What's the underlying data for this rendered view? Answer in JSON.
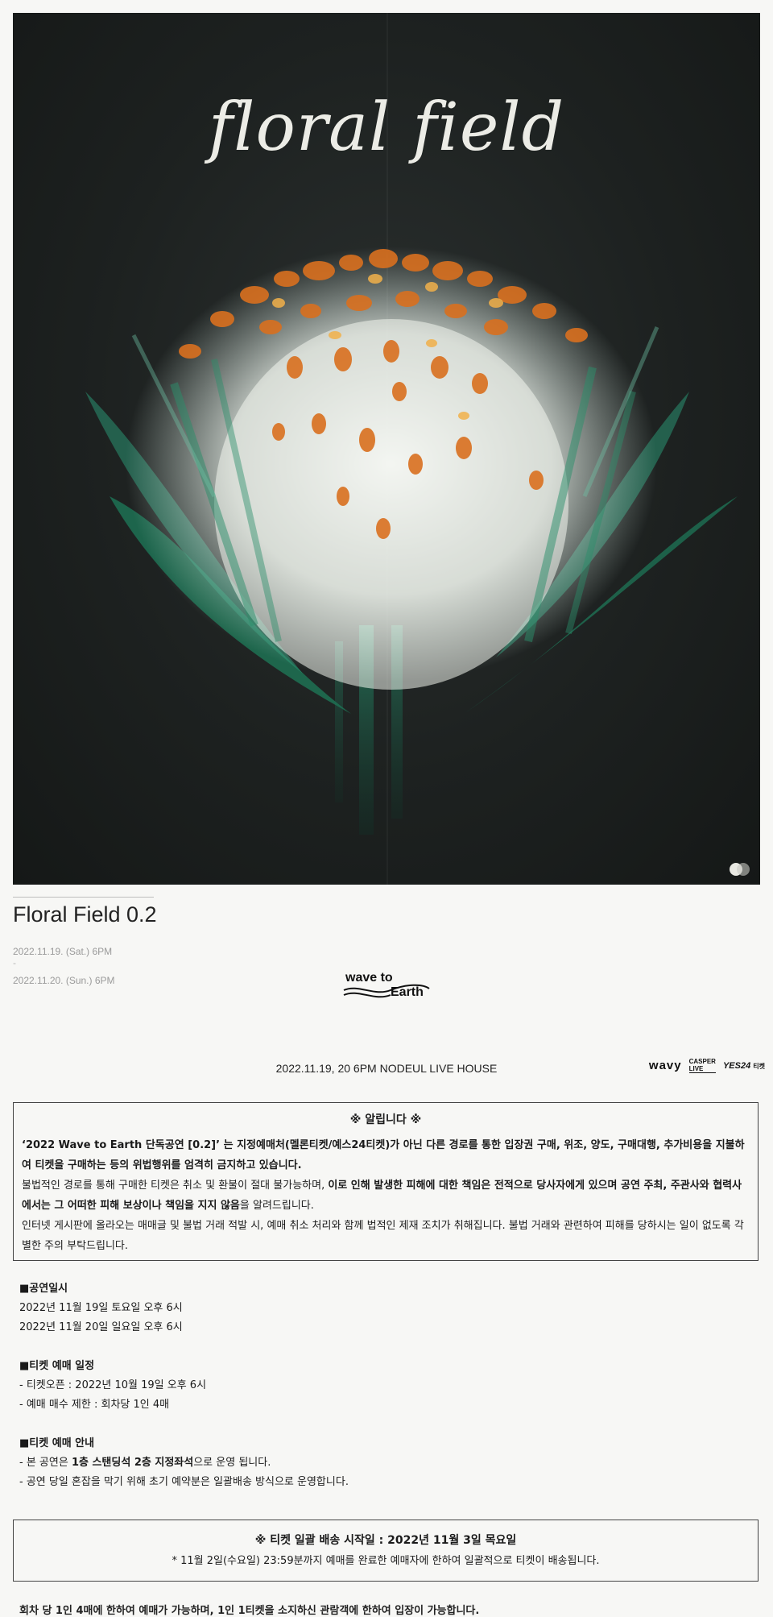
{
  "poster": {
    "title": "floral field"
  },
  "event": {
    "title": "Floral Field 0.2",
    "date1": "2022.11.19. (Sat.) 6PM",
    "separator": "-",
    "date2": "2022.11.20. (Sun.) 6PM",
    "band_logo_line1": "wave to",
    "band_logo_line2": "Earth"
  },
  "venue": {
    "line": "2022.11.19, 20 6PM NODEUL LIVE HOUSE"
  },
  "sponsors": {
    "wavy": "wavy",
    "casper_top": "CASPER",
    "casper_bottom": "LIVE",
    "yes24": "YES24",
    "yes24_suffix": "티켓"
  },
  "notice": {
    "title": "※ 알립니다 ※",
    "p1_bold": "‘2022 Wave to Earth 단독공연 [0.2]’ 는 지정예매처(멜론티켓/예스24티켓)가 아닌 다른 경로를 통한 입장권 구매, 위조, 양도, 구매대행, 추가비용을 지불하여 티켓을 구매하는 등의 위법행위를 엄격히 금지하고 있습니다.",
    "p2_normal": "불법적인 경로를 통해 구매한 티켓은 취소 및 환불이 절대 불가능하며, ",
    "p2_bold": "이로 인해 발생한 피해에 대한 책임은 전적으로 당사자에게 있으며 공연 주최, 주관사와 협력사에서는 그 어떠한 피해 보상이나 책임을 지지 않음",
    "p2_tail": "을 알려드립니다.",
    "p3": "인터넷 게시판에 올라오는 매매글 및 불법 거래 적발 시, 예매 취소 처리와 함께 법적인 제재 조치가 취해집니다. 불법 거래와 관련하여 피해를 당하시는 일이 없도록 각별한 주의 부탁드립니다."
  },
  "schedule": {
    "heading": "■공연일시",
    "line1": "2022년 11월 19일 토요일 오후 6시",
    "line2": "2022년 11월 20일 일요일 오후 6시"
  },
  "booking_schedule": {
    "heading": "■티켓 예매 일정",
    "line1": "- 티켓오픈 : 2022년 10월 19일 오후 6시",
    "line2": "- 예매 매수 제한 : 회차당 1인 4매"
  },
  "booking_info": {
    "heading": "■티켓 예매 안내",
    "line1_pre": "- 본 공연은 ",
    "line1_b1": "1층 스탠딩석 2층 지정좌석",
    "line1_post": "으로 운영 됩니다.",
    "line2": "- 공연 당일 혼잡을 막기 위해 초기 예약분은 일괄배송 방식으로 운영합니다."
  },
  "delivery": {
    "title": "※ 티켓 일괄 배송 시작일 : 2022년 11월 3일 목요일",
    "sub": "* 11월 2일(수요일) 23:59분까지 예매를 완료한 예매자에 한하여 일괄적으로 티켓이 배송됩니다."
  },
  "cutoff": {
    "text": "회차 당 1인 4매에 한하여 예매가 가능하며, 1인 1티켓을 소지하신 관람객에 한하여 입장이 가능합니다."
  },
  "colors": {
    "poster_bg": "#1d2120",
    "petal_orange": "#d9701f",
    "stem_green": "#1f7a5c",
    "flower_white": "#ecefe9"
  }
}
